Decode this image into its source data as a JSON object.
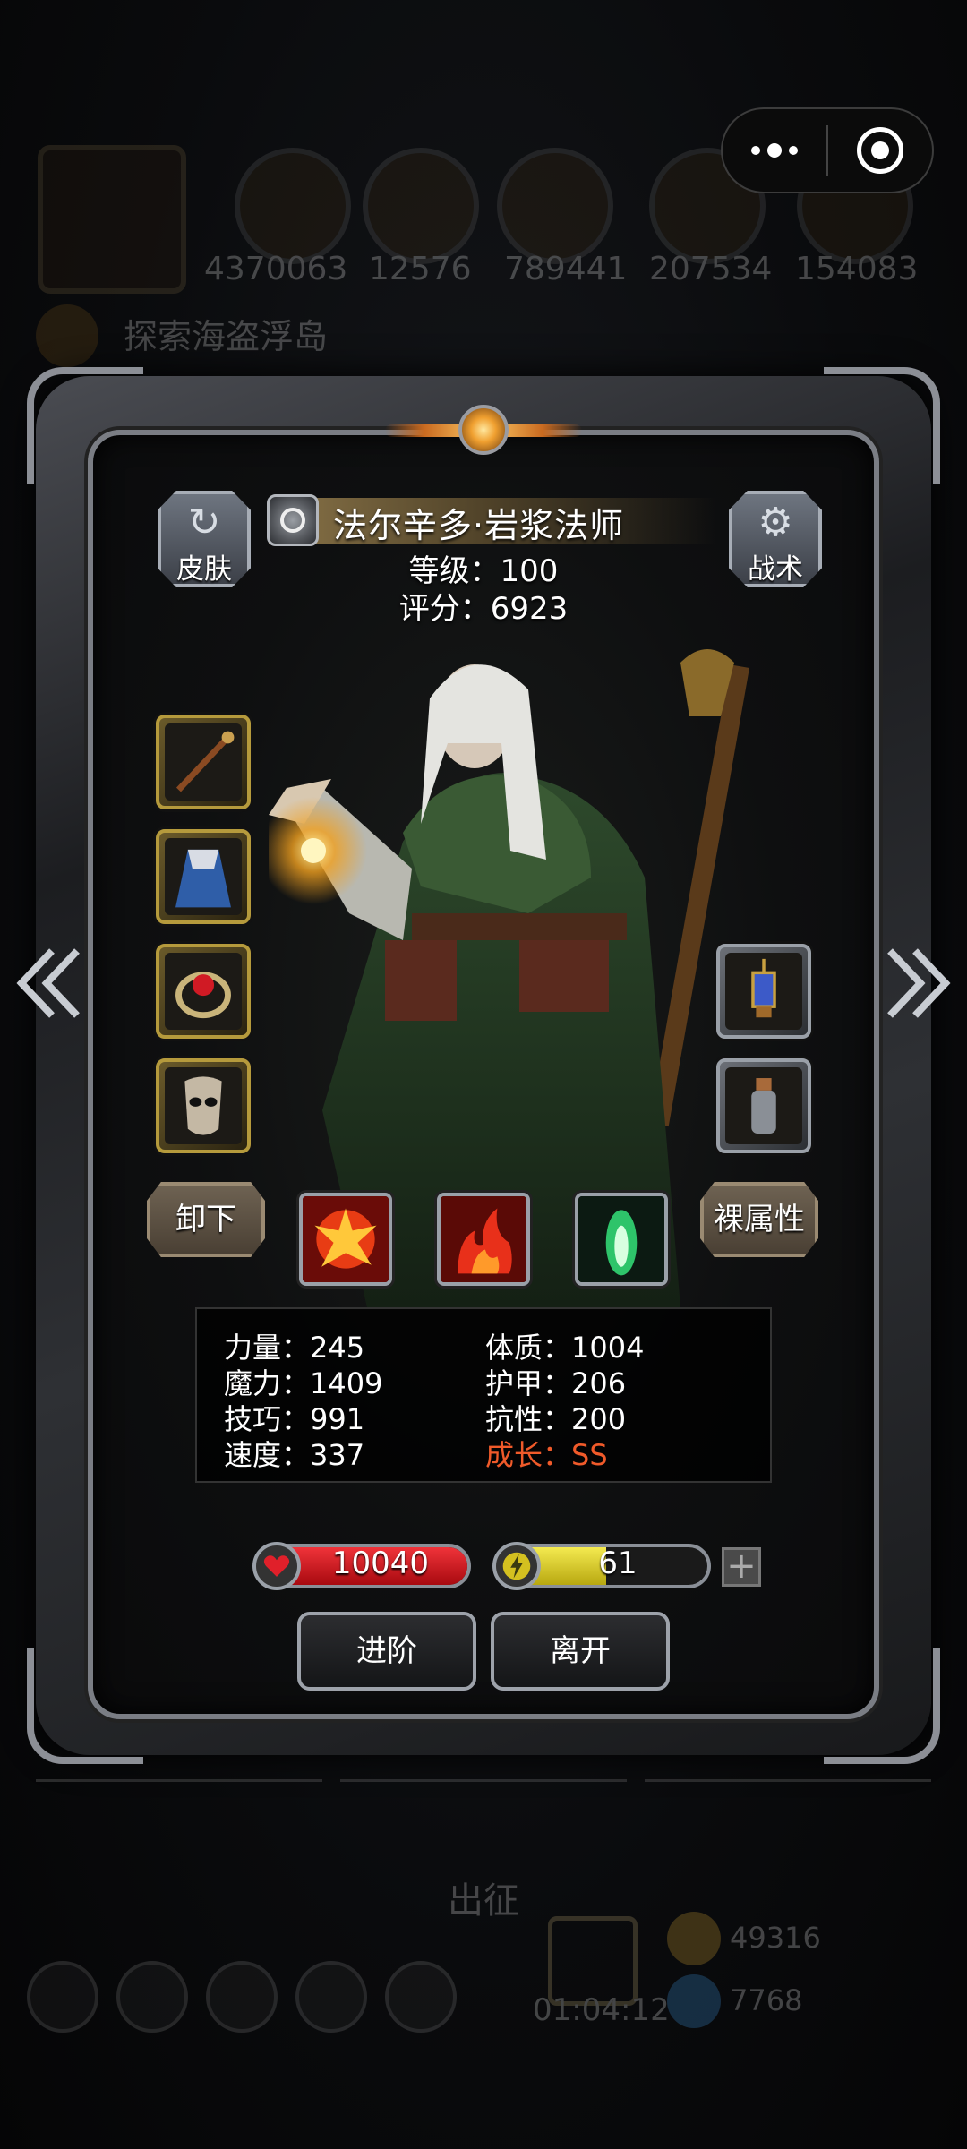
{
  "background": {
    "resources": [
      "4370063",
      "12576",
      "789441",
      "207534",
      "154083"
    ],
    "quest_label": "探索海盗浮岛",
    "expedition_label": "出征",
    "timer": "01:04:12",
    "gold": "49316",
    "gems": "7768"
  },
  "capsule": {
    "more_icon": "more-dots-icon",
    "close_icon": "target-close-icon"
  },
  "header": {
    "skin_label": "皮肤",
    "tactics_label": "战术",
    "hero_name": "法尔辛多·岩浆法师",
    "level": "等级：100",
    "score": "评分：6923"
  },
  "equipment": {
    "left_slots": [
      "staff-icon",
      "cloak-icon",
      "ring-icon",
      "mask-icon"
    ],
    "right_slots": [
      "lantern-icon",
      "potion-bottle-icon"
    ]
  },
  "actions": {
    "unequip_label": "卸下",
    "base_attr_label": "裸属性",
    "advance_label": "进阶",
    "leave_label": "离开"
  },
  "skills": [
    "explosion-skill-icon",
    "fire-skill-icon",
    "green-flame-skill-icon"
  ],
  "stats": {
    "strength": "力量：245",
    "constitution": "体质：1004",
    "magic": "魔力：1409",
    "armor": "护甲：206",
    "skill": "技巧：991",
    "resistance": "抗性：200",
    "speed": "速度：337",
    "growth": "成长：SS"
  },
  "bars": {
    "hp": "10040",
    "hp_fraction": 1.0,
    "energy": "61",
    "energy_fraction": 0.5
  },
  "colors": {
    "hp_red": "#d0141a",
    "energy_yellow": "#e8dc2a",
    "growth_orange": "#f05a2a",
    "gold_trim": "#b59a3c"
  }
}
